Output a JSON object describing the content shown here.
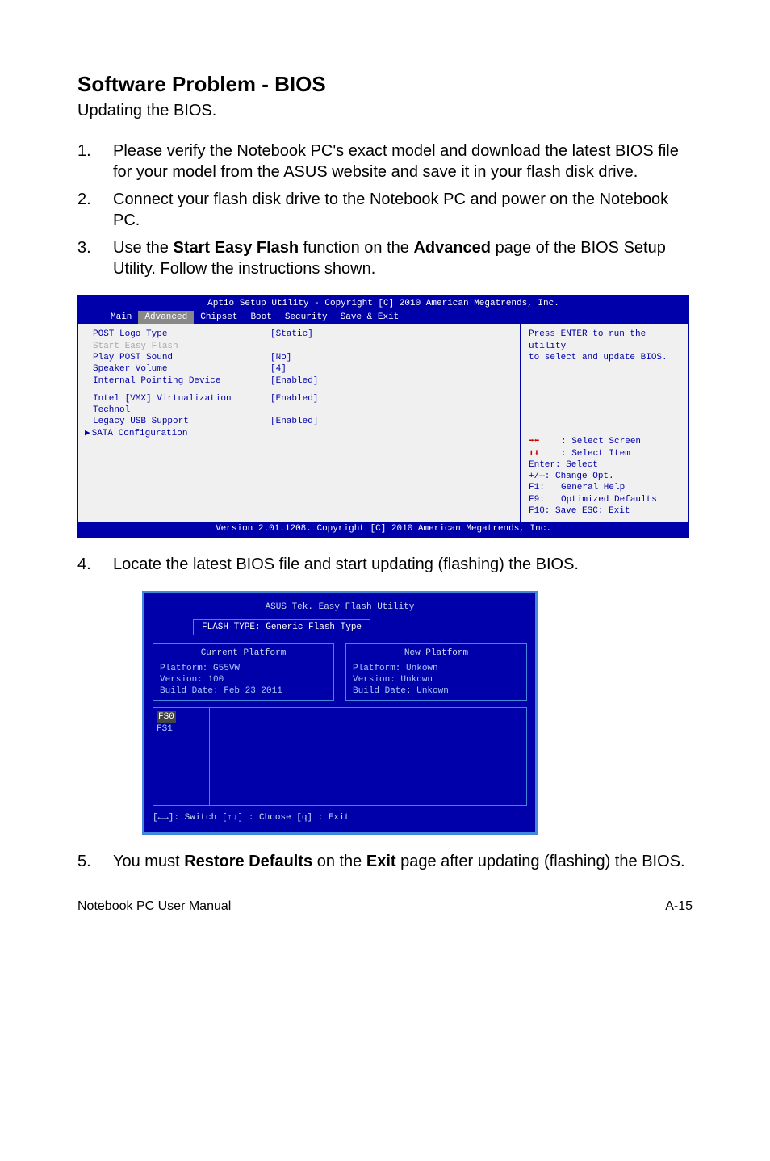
{
  "heading": "Software Problem - BIOS",
  "sub": "Updating the BIOS.",
  "steps": {
    "s1_num": "1.",
    "s1": "Please verify the Notebook PC's exact model and download the latest BIOS file for your model from the ASUS website and save it in your flash disk drive.",
    "s2_num": "2.",
    "s2": "Connect your flash disk drive to the Notebook PC and power on the Notebook PC.",
    "s3_num": "3.",
    "s3_a": "Use the ",
    "s3_b": "Start Easy Flash",
    "s3_c": " function on the ",
    "s3_d": "Advanced",
    "s3_e": " page of the BIOS Setup Utility. Follow the instructions shown.",
    "s4_num": "4.",
    "s4": "Locate the latest BIOS file and start updating (flashing) the BIOS.",
    "s5_num": "5.",
    "s5_a": "You must ",
    "s5_b": "Restore Defaults",
    "s5_c": " on the ",
    "s5_d": "Exit",
    "s5_e": " page after updating (flashing) the BIOS."
  },
  "bios1": {
    "header": "Aptio Setup Utility - Copyright [C] 2010 American Megatrends, Inc.",
    "tabs": {
      "main": "Main",
      "advanced": "Advanced",
      "chipset": "Chipset",
      "boot": "Boot",
      "security": "Security",
      "saveexit": "Save & Exit"
    },
    "opts": {
      "postlogo": "POST Logo Type",
      "postlogo_v": "[Static]",
      "sef": "Start Easy Flash",
      "playpost": "Play POST Sound",
      "playpost_v": "[No]",
      "spkvol": "Speaker Volume",
      "spkvol_v": "[4]",
      "ipd": "Internal Pointing Device",
      "ipd_v": "[Enabled]",
      "vmx": "Intel [VMX] Virtualization Technol",
      "vmx_v": "[Enabled]",
      "legacy": "Legacy USB Support",
      "legacy_v": "[Enabled]",
      "sata": "SATA Configuration"
    },
    "side": {
      "desc1": "Press ENTER to run the utility",
      "desc2": "to select and update BIOS.",
      "sel_screen": "Select Screen",
      "sel_item": "Select Item",
      "enter": "Enter: Select",
      "pm": "+/—:  Change Opt.",
      "f1k": "F1:",
      "f1v": "General Help",
      "f9k": "F9:",
      "f9v": "Optimized Defaults",
      "f10": "F10:  Save    ESC:  Exit"
    },
    "footer": "Version 2.01.1208. Copyright [C] 2010 American Megatrends, Inc."
  },
  "bios2": {
    "title": "ASUS Tek. Easy Flash Utility",
    "flashtype": "FLASH TYPE: Generic Flash Type",
    "cur": {
      "h": "Current Platform",
      "p": "Platform:   G55VW",
      "v": "Version:    100",
      "b": "Build Date: Feb 23 2011"
    },
    "new": {
      "h": "New Platform",
      "p": "Platform:   Unkown",
      "v": "Version:    Unkown",
      "b": "Build Date: Unkown"
    },
    "fs0": "FS0",
    "fs1": "FS1",
    "hints": "[←→]: Switch   [↑↓] : Choose   [q] : Exit"
  },
  "footer": {
    "left": "Notebook PC User Manual",
    "right": "A-15"
  }
}
